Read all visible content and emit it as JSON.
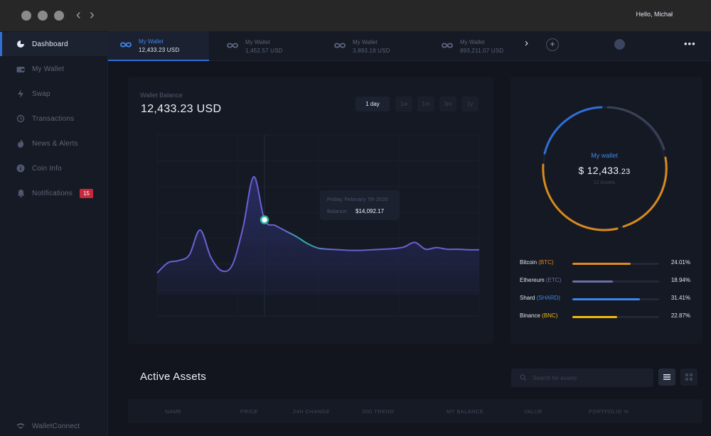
{
  "sidebar": {
    "items": [
      {
        "label": "Dashboard",
        "icon": "pie-chart-icon",
        "active": true
      },
      {
        "label": "My Wallet",
        "icon": "wallet-icon"
      },
      {
        "label": "Swap",
        "icon": "lightning-icon"
      },
      {
        "label": "Transactions",
        "icon": "history-icon"
      },
      {
        "label": "News & Alerts",
        "icon": "fire-icon"
      },
      {
        "label": "Coin Info",
        "icon": "info-icon"
      },
      {
        "label": "Notifications",
        "icon": "bell-icon",
        "badge": "15"
      }
    ],
    "footer": {
      "label": "WalletConnect"
    }
  },
  "wallets": [
    {
      "name": "My Wallet",
      "balance": "12,433.23 USD",
      "active": true
    },
    {
      "name": "My Wallet",
      "balance": "1,452.57 USD"
    },
    {
      "name": "My Wallet",
      "balance": "3,893.19 USD"
    },
    {
      "name": "My Wallet",
      "balance": "893,211.07 USD"
    }
  ],
  "header": {
    "greeting": "Hello, Michał",
    "more": "•••"
  },
  "balance_card": {
    "label": "Wallet Balance",
    "value": "12,433.23 USD",
    "ranges": [
      "1 day",
      "1w",
      "1m",
      "3m",
      "1y"
    ],
    "active_range": "1 day",
    "tooltip": {
      "date": "Friday, February 7th 2020",
      "balance_label": "Balance:",
      "balance_value": "$14,092.17"
    }
  },
  "chart_data": {
    "type": "area",
    "x": [
      0,
      1,
      2,
      3,
      4,
      5,
      6,
      7,
      8,
      9,
      10,
      11,
      12,
      13,
      14,
      15,
      16,
      17,
      18,
      19,
      20,
      21,
      22,
      23,
      24,
      25,
      26,
      27,
      28,
      29,
      30
    ],
    "values": [
      7800,
      8700,
      8900,
      9400,
      11600,
      9200,
      8000,
      8500,
      11800,
      16300,
      12500,
      12000,
      11500,
      11000,
      10400,
      10000,
      9900,
      9850,
      9800,
      9800,
      9850,
      9900,
      9950,
      10100,
      10500,
      9900,
      10050,
      9900,
      9900,
      9850,
      9850
    ],
    "highlight_index": 10,
    "ylim": [
      4000,
      20000
    ],
    "grid": true,
    "colors": {
      "line_start": "#6c5fd4",
      "line_peak": "#2bb3a4",
      "fill": "#2a2f6a"
    }
  },
  "portfolio": {
    "title": "My wallet",
    "value_main": "$ 12,433",
    "value_cents": ".23",
    "sub": "12 Assets",
    "assets": [
      {
        "name": "Bitcoin",
        "ticker": "(BTC)",
        "percent": "24.01%",
        "fraction": 0.67,
        "color": "#e08a1e"
      },
      {
        "name": "Ethereum",
        "ticker": "(ETC)",
        "percent": "18.94%",
        "fraction": 0.47,
        "color": "#6b6fa6"
      },
      {
        "name": "Shard",
        "ticker": "(SHARD)",
        "percent": "31.41%",
        "fraction": 0.78,
        "color": "#3a86ea"
      },
      {
        "name": "Binance",
        "ticker": "(BNC)",
        "percent": "22.87%",
        "fraction": 0.52,
        "color": "#f0b90b"
      }
    ]
  },
  "active_assets": {
    "title": "Active Assets",
    "search_placeholder": "Search for assets",
    "columns": [
      "NAME",
      "PRICE",
      "24H CHANGE",
      "30D TREND",
      "MY BALANCE",
      "VALUE",
      "PORTFOLIO %"
    ]
  }
}
